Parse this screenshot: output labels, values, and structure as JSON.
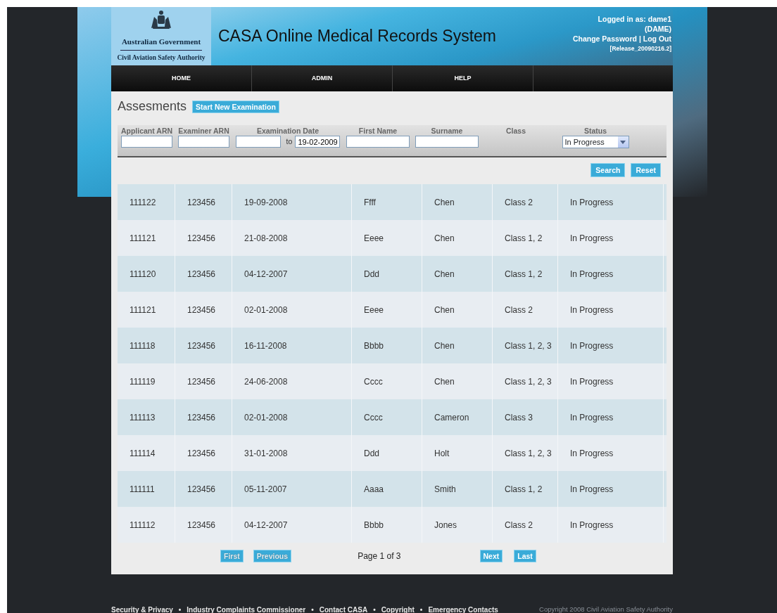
{
  "header": {
    "logo": {
      "line_1": "Australian Government",
      "line_2": "Civil Aviation Safety Authority"
    },
    "title": "CASA Online Medical Records System",
    "user": {
      "logged_in": "Logged in as: dame1",
      "role": "(DAME)",
      "change_password": "Change Password",
      "separator": "|",
      "log_out": "Log Out",
      "release": "[Release_20090216.2]"
    }
  },
  "nav": [
    {
      "label": "HOME"
    },
    {
      "label": "ADMIN"
    },
    {
      "label": "HELP"
    }
  ],
  "page_title": "Assesments",
  "start_button": "Start New Examination",
  "filters": [
    {
      "kind": "input",
      "label": "Applicant ARN"
    },
    {
      "kind": "input",
      "label": "Examiner ARN"
    },
    {
      "kind": "daterange",
      "label": "Examination Date",
      "to_label": "to",
      "to_value": "19-02-2009"
    },
    {
      "kind": "input",
      "label": "First Name"
    },
    {
      "kind": "input",
      "label": "Surname"
    },
    {
      "kind": "none",
      "label": "Class"
    },
    {
      "kind": "select",
      "label": "Status",
      "value": "In Progress"
    }
  ],
  "filter_buttons": [
    "Search",
    "Reset"
  ],
  "rows": [
    [
      "111122",
      "123456",
      "19-09-2008",
      "Ffff",
      "Chen",
      "Class 2",
      "In Progress"
    ],
    [
      "111121",
      "123456",
      "21-08-2008",
      "Eeee",
      "Chen",
      "Class 1, 2",
      "In Progress"
    ],
    [
      "111120",
      "123456",
      "04-12-2007",
      "Ddd",
      "Chen",
      "Class 1, 2",
      "In Progress"
    ],
    [
      "111121",
      "123456",
      "02-01-2008",
      "Eeee",
      "Chen",
      "Class 2",
      "In Progress"
    ],
    [
      "111118",
      "123456",
      "16-11-2008",
      "Bbbb",
      "Chen",
      "Class 1, 2, 3",
      "In Progress"
    ],
    [
      "111119",
      "123456",
      "24-06-2008",
      "Cccc",
      "Chen",
      "Class 1, 2, 3",
      "In Progress"
    ],
    [
      "111113",
      "123456",
      "02-01-2008",
      "Cccc",
      "Cameron",
      "Class 3",
      "In Progress"
    ],
    [
      "111114",
      "123456",
      "31-01-2008",
      "Ddd",
      "Holt",
      "Class 1, 2, 3",
      "In Progress"
    ],
    [
      "111111",
      "123456",
      "05-11-2007",
      "Aaaa",
      "Smith",
      "Class 1, 2",
      "In Progress"
    ],
    [
      "111112",
      "123456",
      "04-12-2007",
      "Bbbb",
      "Jones",
      "Class 2",
      "In Progress"
    ]
  ],
  "pagination": {
    "first": {
      "label": "First",
      "disabled": true
    },
    "previous": {
      "label": "Previous",
      "disabled": true
    },
    "page": "Page 1 of 3",
    "next": {
      "label": "Next",
      "disabled": false
    },
    "last": {
      "label": "Last",
      "disabled": false
    }
  },
  "footer": {
    "links": [
      "Security & Privacy",
      "Industry Complaints Commissioner",
      "Contact CASA",
      "Copyright",
      "Emergency Contacts"
    ],
    "separator": "•",
    "copyright": "Copyright 2008 Civil Aviation Safety Authority"
  }
}
